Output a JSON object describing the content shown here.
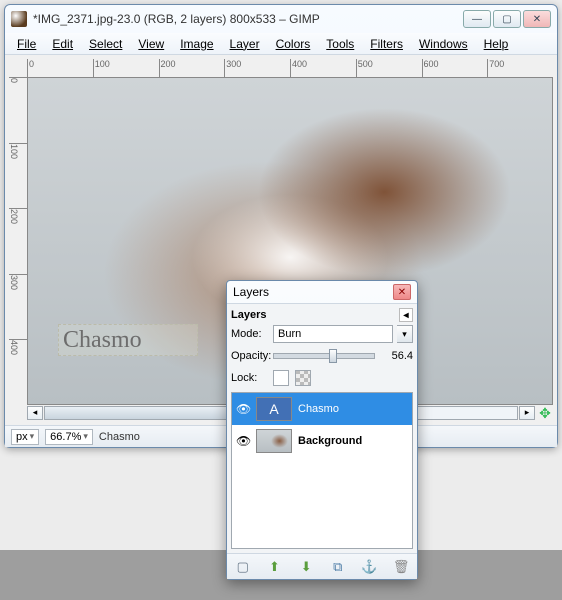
{
  "window": {
    "title": "*IMG_2371.jpg-23.0 (RGB, 2 layers) 800x533 – GIMP",
    "icon": "gimp-wilber-icon"
  },
  "menubar": {
    "items": [
      "File",
      "Edit",
      "Select",
      "View",
      "Image",
      "Layer",
      "Colors",
      "Tools",
      "Filters",
      "Windows",
      "Help"
    ]
  },
  "ruler": {
    "top_ticks": [
      "0",
      "100",
      "200",
      "300",
      "400",
      "500",
      "600",
      "700"
    ],
    "left_ticks": [
      "0",
      "100",
      "200",
      "300",
      "400"
    ]
  },
  "canvas": {
    "watermark_text": "Chasmo"
  },
  "statusbar": {
    "units": "px",
    "zoom": "66.7%",
    "layer": "Chasmo"
  },
  "layers_dialog": {
    "title": "Layers",
    "panel_label": "Layers",
    "mode_label": "Mode:",
    "mode_value": "Burn",
    "opacity_label": "Opacity:",
    "opacity_value": "56.4",
    "lock_label": "Lock:",
    "layers": [
      {
        "name": "Chasmo",
        "visible": true,
        "type": "text",
        "selected": true
      },
      {
        "name": "Background",
        "visible": true,
        "type": "image",
        "selected": false
      }
    ],
    "footer_icons": [
      "new-layer",
      "raise-layer",
      "lower-layer",
      "duplicate-layer",
      "anchor-layer",
      "delete-layer"
    ]
  }
}
